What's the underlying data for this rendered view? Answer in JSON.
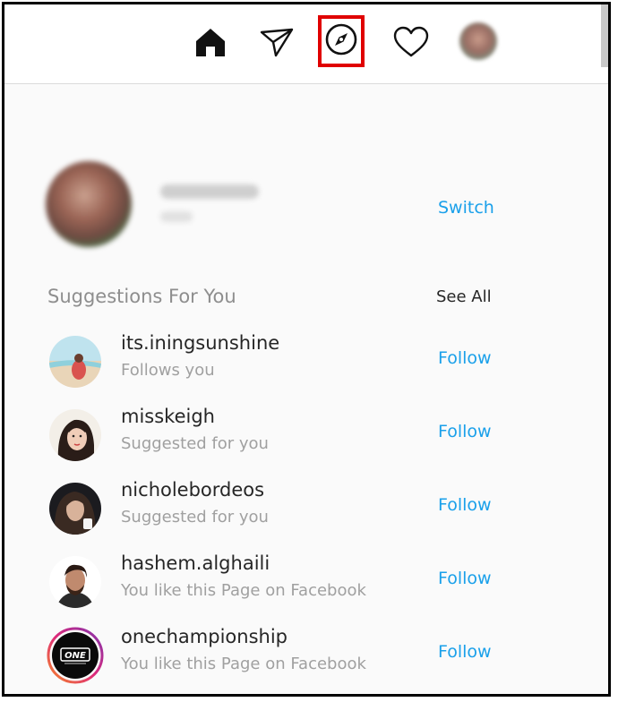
{
  "nav": {
    "icons": [
      "home-icon",
      "direct-message-icon",
      "explore-compass-icon",
      "activity-heart-icon",
      "profile-avatar"
    ],
    "highlight_color": "#e00000"
  },
  "current_user": {
    "switch_label": "Switch"
  },
  "suggestions": {
    "title": "Suggestions For You",
    "see_all": "See All",
    "items": [
      {
        "username": "its.iningsunshine",
        "subtitle": "Follows you",
        "action": "Follow"
      },
      {
        "username": "misskeigh",
        "subtitle": "Suggested for you",
        "action": "Follow"
      },
      {
        "username": "nicholebordeos",
        "subtitle": "Suggested for you",
        "action": "Follow"
      },
      {
        "username": "hashem.alghaili",
        "subtitle": "You like this Page on Facebook",
        "action": "Follow"
      },
      {
        "username": "onechampionship",
        "subtitle": "You like this Page on Facebook",
        "action": "Follow",
        "avatar_text": "ONE"
      }
    ]
  },
  "colors": {
    "link": "#1aa0ea",
    "muted": "#8e8e8e",
    "text": "#262626"
  }
}
